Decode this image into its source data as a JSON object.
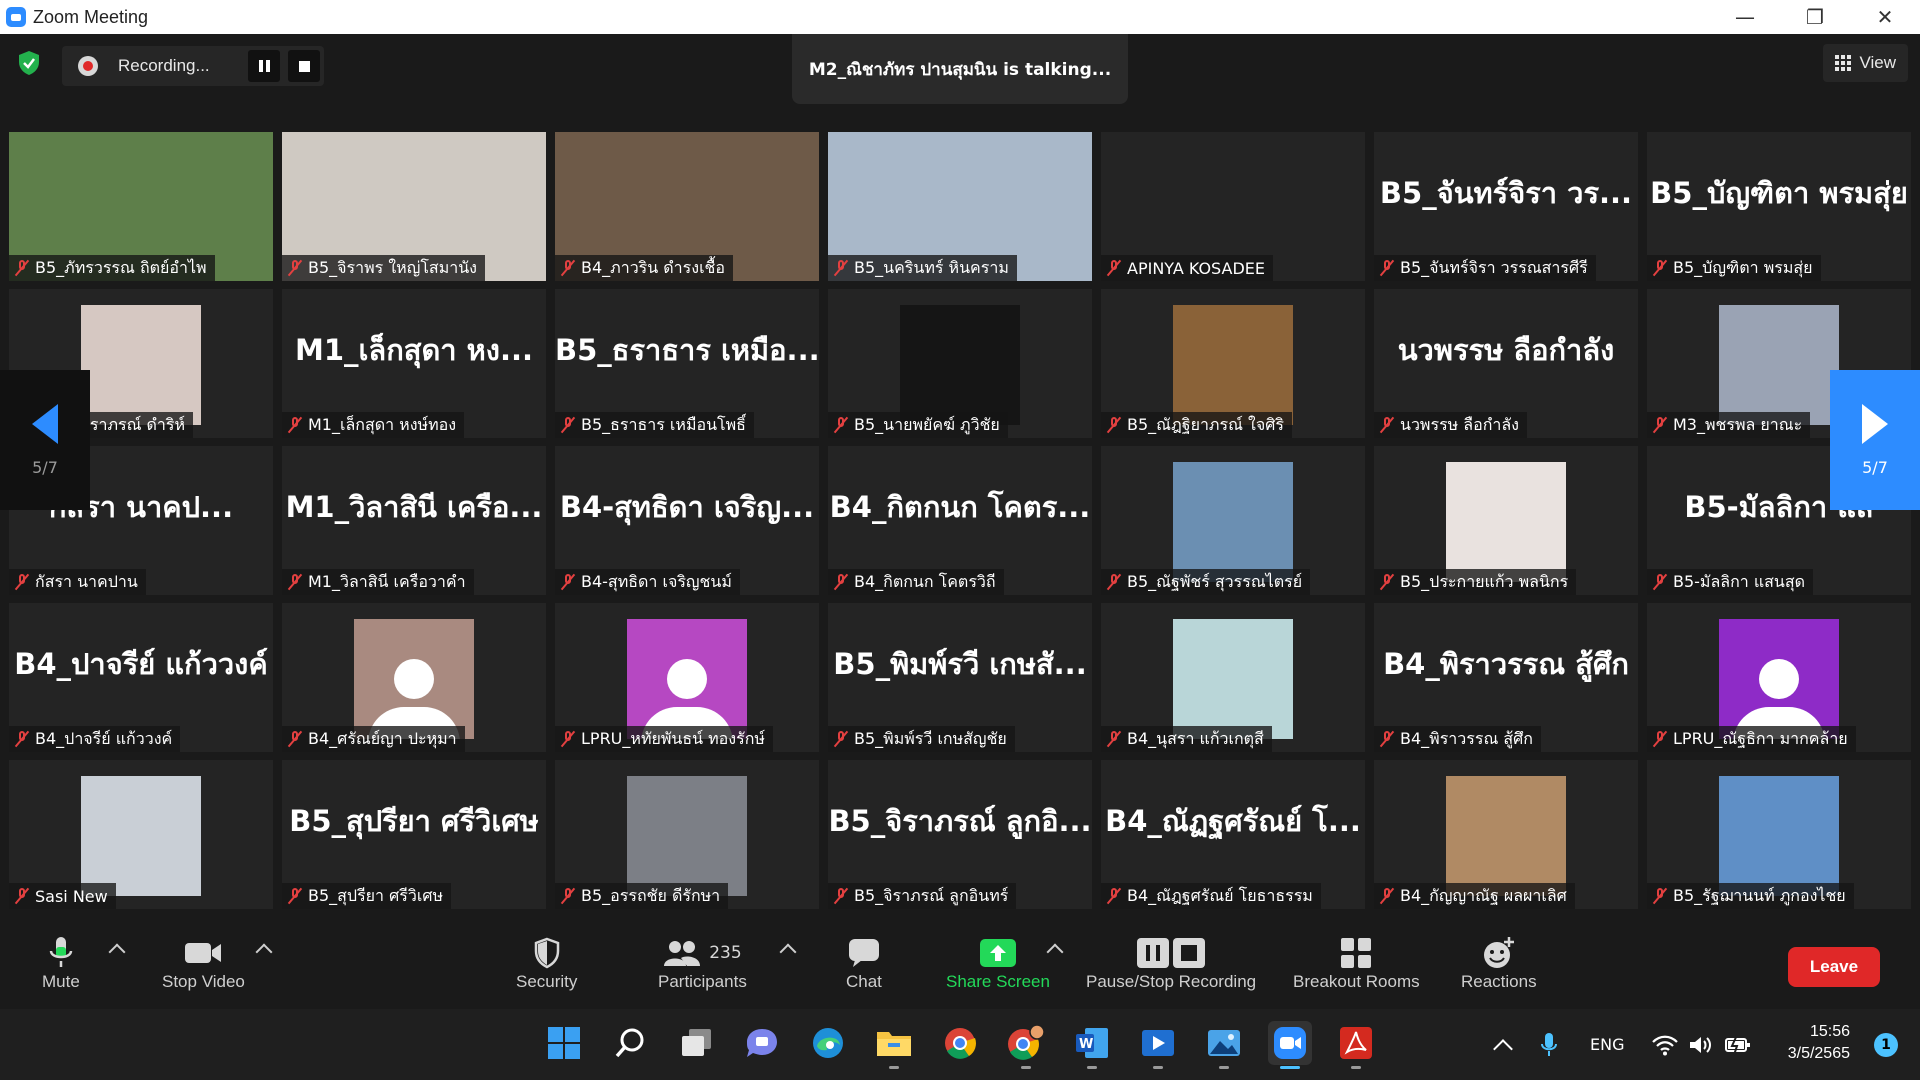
{
  "window": {
    "title": "Zoom Meeting",
    "minimize": "—",
    "restore": "❐",
    "close": "✕"
  },
  "top": {
    "recording_label": "Recording...",
    "talking_banner": "M2_ณิชาภัทร ปานสุมนิน is talking...",
    "view_label": "View"
  },
  "pager": {
    "left_page": "5/7",
    "right_page": "5/7"
  },
  "tiles": [
    {
      "name": "B5_ภัทรวรรณ ถิตย์อำไพ",
      "big": "",
      "kind": "video",
      "color": "#5e7f4a"
    },
    {
      "name": "B5_จิราพร ใหญ่โสมานัง",
      "big": "",
      "kind": "video",
      "color": "#cfc9c2"
    },
    {
      "name": "B4_ภาวริน ดำรงเชื้อ",
      "big": "",
      "kind": "video",
      "color": "#6e5a48"
    },
    {
      "name": "B5_นครินทร์ หินคราม",
      "big": "",
      "kind": "video",
      "color": "#a9b8c9"
    },
    {
      "name": "APINYA KOSADEE",
      "big": "",
      "kind": "blank",
      "color": ""
    },
    {
      "name": "B5_จันทร์จิรา วรรณสารศีรี",
      "big": "B5_จันทร์จิรา วร...",
      "kind": "text",
      "color": ""
    },
    {
      "name": "B5_บัญฑิตา พรมสุ่ย",
      "big": "B5_บัญฑิตา พรมสุ่ย",
      "kind": "text",
      "color": ""
    },
    {
      "name": "B4_เกษราภรณ์ ดำริห์",
      "big": "",
      "kind": "photo",
      "color": "#d6c8c2"
    },
    {
      "name": "M1_เล็กสุดา หงษ์ทอง",
      "big": "M1_เล็กสุดา หง...",
      "kind": "text",
      "color": ""
    },
    {
      "name": "B5_ธราธาร เหมือนโพธิ์",
      "big": "B5_ธราธาร เหมือ...",
      "kind": "text",
      "color": ""
    },
    {
      "name": "B5_นายพยัคฆ์ ภูวิชัย",
      "big": "",
      "kind": "photo",
      "color": "#151515"
    },
    {
      "name": "B5_ณัฎฐิยาภรณ์ ใจศิริ",
      "big": "",
      "kind": "photo",
      "color": "#8a6238"
    },
    {
      "name": "นวพรรษ ลือกำลัง",
      "big": "นวพรรษ ลือกำลัง",
      "kind": "text",
      "color": ""
    },
    {
      "name": "M3_พชรพล ยาณะ",
      "big": "",
      "kind": "photo",
      "color": "#9aa3b4"
    },
    {
      "name": "กัสรา นาคปาน",
      "big": "กัสรา นาคป...",
      "kind": "text",
      "color": ""
    },
    {
      "name": "M1_วิลาสินี เครือวาคำ",
      "big": "M1_วิลาสินี เครือ...",
      "kind": "text",
      "color": ""
    },
    {
      "name": "B4-สุทธิดา เจริญชนม์",
      "big": "B4-สุทธิดา เจริญ...",
      "kind": "text",
      "color": ""
    },
    {
      "name": "B4_กิตกนก โคตรวิถี",
      "big": "B4_กิตกนก โคตร...",
      "kind": "text",
      "color": ""
    },
    {
      "name": "B5_ณัฐพัชร์ สุวรรณไตรย์",
      "big": "",
      "kind": "photo",
      "color": "#6b8fb2"
    },
    {
      "name": "B5_ประกายแก้ว พลนิกร",
      "big": "",
      "kind": "photo",
      "color": "#e9e2df"
    },
    {
      "name": "B5-มัลลิกา แสนสุด",
      "big": "B5-มัลลิกา แส",
      "kind": "text",
      "color": ""
    },
    {
      "name": "B4_ปาจรีย์ แก้ววงค์",
      "big": "B4_ปาจรีย์ แก้ววงค์",
      "kind": "text",
      "color": ""
    },
    {
      "name": "B4_ศรัณย์ญา ปะหุมา",
      "big": "",
      "kind": "avatar",
      "color": "#a98a80"
    },
    {
      "name": "LPRU_หทัยพันธน์ ทองรักษ์",
      "big": "",
      "kind": "avatar",
      "color": "#b648c2"
    },
    {
      "name": "B5_พิมพ์รวี เกษสัญชัย",
      "big": "B5_พิมพ์รวี เกษสั...",
      "kind": "text",
      "color": ""
    },
    {
      "name": "B4_นุสรา แก้วเกตุสี",
      "big": "",
      "kind": "photo",
      "color": "#b9d6d8"
    },
    {
      "name": "B4_พิราวรรณ สู้ศึก",
      "big": "B4_พิราวรรณ สู้ศึก",
      "kind": "text",
      "color": ""
    },
    {
      "name": "LPRU_ณัฐธิกา มากคล้าย",
      "big": "",
      "kind": "avatar",
      "color": "#8e2bc7"
    },
    {
      "name": "Sasi New",
      "big": "",
      "kind": "photo",
      "color": "#c9cfd6"
    },
    {
      "name": "B5_สุปรียา ศรีวิเศษ",
      "big": "B5_สุปรียา ศรีวิเศษ",
      "kind": "text",
      "color": ""
    },
    {
      "name": "B5_อรรถชัย ดีรักษา",
      "big": "",
      "kind": "photo",
      "color": "#7c7f86"
    },
    {
      "name": "B5_จิราภรณ์ ลูกอินทร์",
      "big": "B5_จิราภรณ์ ลูกอิ...",
      "kind": "text",
      "color": ""
    },
    {
      "name": "B4_ณัฎฐศรัณย์ โยธาธรรม",
      "big": "B4_ณัฏฐศรัณย์ โ...",
      "kind": "text",
      "color": ""
    },
    {
      "name": "B4_กัญญาณัฐ ผลผาเลิศ",
      "big": "",
      "kind": "photo",
      "color": "#b08a64"
    },
    {
      "name": "B5_รัฐฌานนท์ ภูกองไชย",
      "big": "",
      "kind": "photo",
      "color": "#5f8fc6"
    }
  ],
  "controls": {
    "mute": "Mute",
    "stop_video": "Stop Video",
    "security": "Security",
    "participants": "Participants",
    "participants_count": "235",
    "chat": "Chat",
    "share_screen": "Share Screen",
    "pause_stop_recording": "Pause/Stop Recording",
    "breakout_rooms": "Breakout Rooms",
    "reactions": "Reactions",
    "leave": "Leave"
  },
  "taskbar": {
    "apps": [
      "windows-start-icon",
      "search-icon",
      "task-view-icon",
      "teams-chat-icon",
      "edge-icon",
      "file-explorer-icon",
      "chrome-icon",
      "chrome-profile-icon",
      "word-icon",
      "media-player-icon",
      "photos-icon",
      "zoom-icon",
      "acrobat-icon"
    ],
    "language": "ENG",
    "time": "15:56",
    "date": "3/5/2565",
    "notifications": "1"
  },
  "colors": {
    "zoom_blue": "#2d8cff",
    "leave_red": "#e02828",
    "share_green": "#23d959",
    "muted_red": "#e34040"
  }
}
